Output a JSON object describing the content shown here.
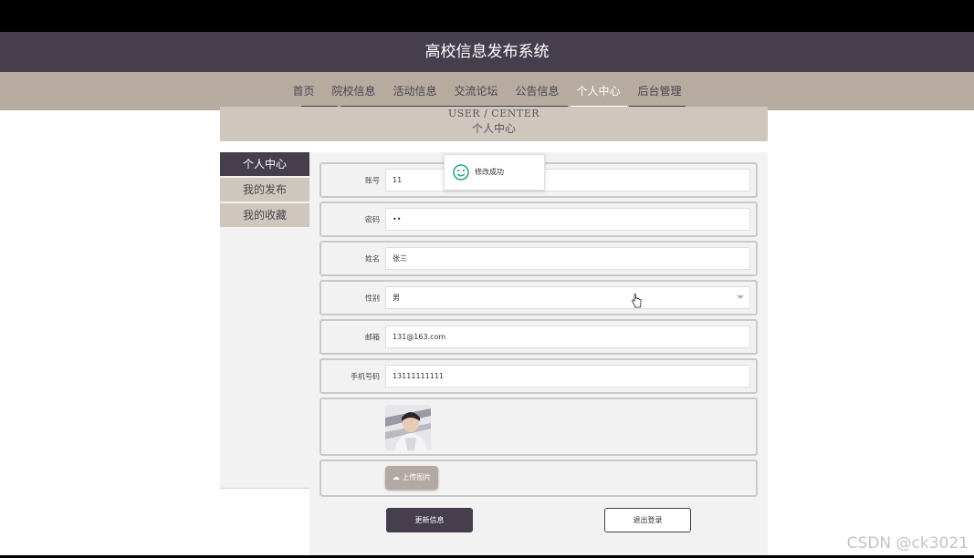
{
  "header": {
    "title": "高校信息发布系统"
  },
  "nav": {
    "items": [
      {
        "label": "首页"
      },
      {
        "label": "院校信息"
      },
      {
        "label": "活动信息"
      },
      {
        "label": "交流论坛"
      },
      {
        "label": "公告信息"
      },
      {
        "label": "个人中心",
        "active": true
      },
      {
        "label": "后台管理"
      }
    ]
  },
  "banner": {
    "en": "USER / CENTER",
    "cn": "个人中心"
  },
  "sidebar": {
    "items": [
      {
        "label": "个人中心",
        "active": true
      },
      {
        "label": "我的发布"
      },
      {
        "label": "我的收藏"
      }
    ]
  },
  "form": {
    "account": {
      "label": "账号",
      "value": "11"
    },
    "password": {
      "label": "密码",
      "value": "••"
    },
    "name": {
      "label": "姓名",
      "value": "张三"
    },
    "gender": {
      "label": "性别",
      "value": "男"
    },
    "email": {
      "label": "邮箱",
      "value": "131@163.com"
    },
    "phone": {
      "label": "手机号码",
      "value": "13111111111"
    },
    "upload_label": "上传图片"
  },
  "buttons": {
    "update": "更新信息",
    "logout": "退出登录"
  },
  "toast": {
    "message": "修改成功"
  },
  "watermark": "CSDN @ck3021",
  "colors": {
    "primary": "#463e4d",
    "nav_bg": "#b7aba0",
    "accent_light": "#cfc6bd"
  },
  "icons": {
    "toast": "smile-icon",
    "upload": "cloud-upload-icon",
    "cursor": "hand-pointer-icon"
  }
}
